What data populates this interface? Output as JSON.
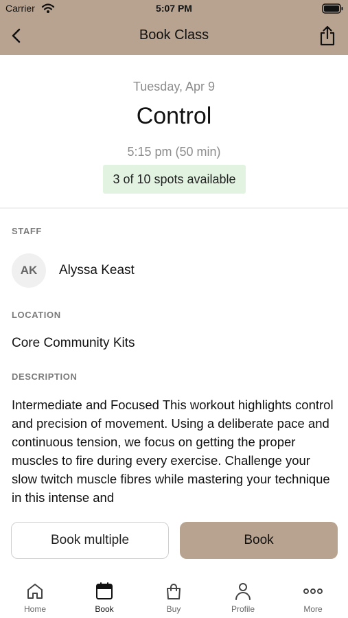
{
  "status_bar": {
    "carrier": "Carrier",
    "time": "5:07 PM"
  },
  "nav": {
    "title": "Book Class",
    "back_icon": "chevron-left-icon",
    "share_icon": "share-icon"
  },
  "class": {
    "date": "Tuesday, Apr 9",
    "name": "Control",
    "time": "5:15 pm (50 min)",
    "spots": "3 of 10 spots available"
  },
  "staff": {
    "label": "STAFF",
    "initials": "AK",
    "name": "Alyssa Keast"
  },
  "location": {
    "label": "LOCATION",
    "name": "Core Community Kits"
  },
  "description": {
    "label": "DESCRIPTION",
    "text": "Intermediate and Focused This workout highlights control and precision of movement. Using a deliberate pace and continuous tension, we focus on getting the proper muscles to fire during every exercise. Challenge your slow twitch muscle fibres while mastering your technique in this intense and"
  },
  "actions": {
    "book_multiple": "Book multiple",
    "book": "Book"
  },
  "tabs": [
    {
      "label": "Home",
      "icon": "home-icon",
      "active": false
    },
    {
      "label": "Book",
      "icon": "calendar-icon",
      "active": true
    },
    {
      "label": "Buy",
      "icon": "shopping-bag-icon",
      "active": false
    },
    {
      "label": "Profile",
      "icon": "person-icon",
      "active": false
    },
    {
      "label": "More",
      "icon": "more-dots-icon",
      "active": false
    }
  ],
  "colors": {
    "header": "#b8a390",
    "book_button": "#b8a390",
    "spots_badge": "#e3f3e2"
  }
}
